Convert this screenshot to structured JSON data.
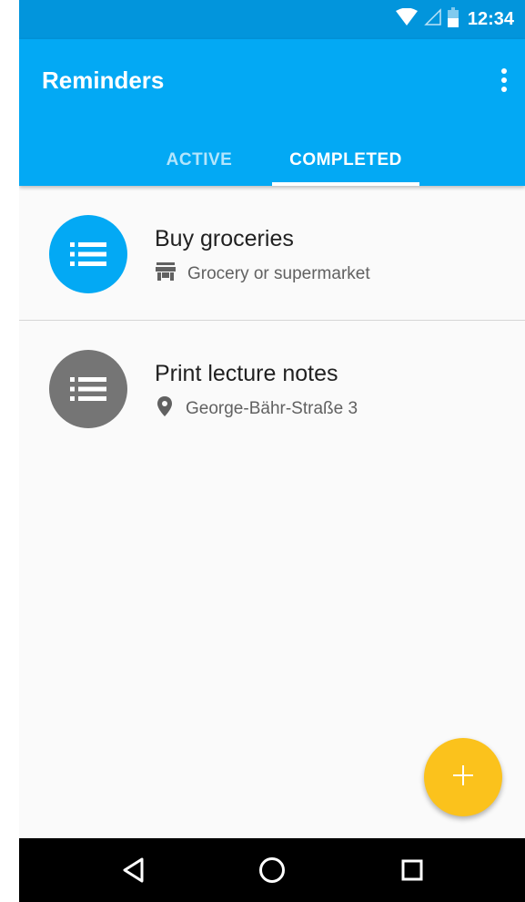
{
  "status_bar": {
    "time": "12:34",
    "icons": [
      "wifi-icon",
      "cell-signal-icon",
      "battery-icon"
    ]
  },
  "app_bar": {
    "title": "Reminders",
    "menu_icon": "more-vert-icon",
    "color": "#03a9f4"
  },
  "tabs": [
    {
      "label": "ACTIVE",
      "selected": false
    },
    {
      "label": "COMPLETED",
      "selected": true
    }
  ],
  "reminders": [
    {
      "title": "Buy groceries",
      "subtitle": "Grocery or supermarket",
      "avatar_icon": "list-icon",
      "avatar_color": "#03a9f4",
      "subtitle_icon": "store-icon"
    },
    {
      "title": "Print lecture notes",
      "subtitle": "George-Bähr-Straße 3",
      "avatar_icon": "list-icon",
      "avatar_color": "#757575",
      "subtitle_icon": "location-pin-icon"
    }
  ],
  "fab": {
    "icon": "plus-icon",
    "color": "#fbc21c"
  },
  "nav_bar": {
    "icons": [
      "back-icon",
      "home-icon",
      "recents-icon"
    ]
  }
}
